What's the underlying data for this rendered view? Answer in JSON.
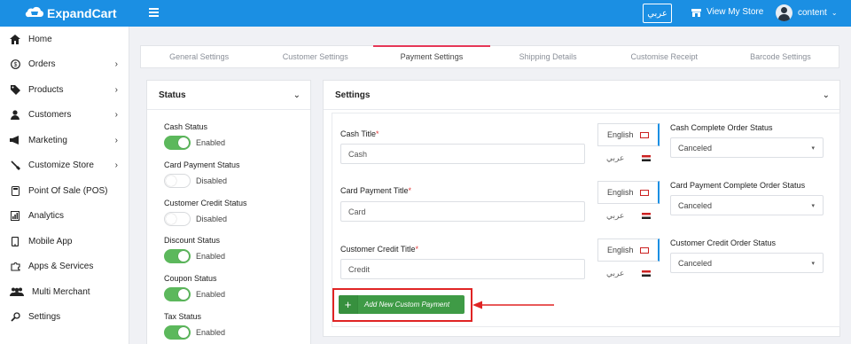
{
  "header": {
    "logo_text": "ExpandCart",
    "lang_button": "عربي",
    "view_store": "View My Store",
    "user_name": "content"
  },
  "sidebar": {
    "items": [
      {
        "label": "Home",
        "icon": "home-icon",
        "has_children": false
      },
      {
        "label": "Orders",
        "icon": "dollar-icon",
        "has_children": true
      },
      {
        "label": "Products",
        "icon": "tag-icon",
        "has_children": true
      },
      {
        "label": "Customers",
        "icon": "user-icon",
        "has_children": true
      },
      {
        "label": "Marketing",
        "icon": "megaphone-icon",
        "has_children": true
      },
      {
        "label": "Customize Store",
        "icon": "brush-icon",
        "has_children": true
      },
      {
        "label": "Point Of Sale (POS)",
        "icon": "pos-icon",
        "has_children": false
      },
      {
        "label": "Analytics",
        "icon": "chart-icon",
        "has_children": false
      },
      {
        "label": "Mobile App",
        "icon": "mobile-icon",
        "has_children": false
      },
      {
        "label": "Apps & Services",
        "icon": "puzzle-icon",
        "has_children": false
      },
      {
        "label": "Multi Merchant",
        "icon": "group-icon",
        "has_children": false
      },
      {
        "label": "Settings",
        "icon": "gear-icon",
        "has_children": false
      }
    ]
  },
  "tabs": [
    {
      "label": "General Settings",
      "active": false
    },
    {
      "label": "Customer Settings",
      "active": false
    },
    {
      "label": "Payment Settings",
      "active": true
    },
    {
      "label": "Shipping Details",
      "active": false
    },
    {
      "label": "Customise Receipt",
      "active": false
    },
    {
      "label": "Barcode Settings",
      "active": false
    }
  ],
  "status_panel": {
    "title": "Status",
    "items": [
      {
        "label": "Cash Status",
        "enabled": true,
        "state_text": "Enabled"
      },
      {
        "label": "Card Payment Status",
        "enabled": false,
        "state_text": "Disabled"
      },
      {
        "label": "Customer Credit Status",
        "enabled": false,
        "state_text": "Disabled"
      },
      {
        "label": "Discount Status",
        "enabled": true,
        "state_text": "Enabled"
      },
      {
        "label": "Coupon Status",
        "enabled": true,
        "state_text": "Enabled"
      },
      {
        "label": "Tax Status",
        "enabled": true,
        "state_text": "Enabled"
      }
    ]
  },
  "settings_panel": {
    "title": "Settings",
    "fields": [
      {
        "label": "Cash Title",
        "value": "Cash",
        "lang_en": "English",
        "lang_ar": "عربي",
        "status_label": "Cash Complete Order Status",
        "status_value": "Canceled"
      },
      {
        "label": "Card Payment Title",
        "value": "Card",
        "lang_en": "English",
        "lang_ar": "عربي",
        "status_label": "Card Payment Complete Order Status",
        "status_value": "Canceled"
      },
      {
        "label": "Customer Credit Title",
        "value": "Credit",
        "lang_en": "English",
        "lang_ar": "عربي",
        "status_label": "Customer Credit Order Status",
        "status_value": "Canceled"
      }
    ],
    "add_button": "Add New Custom Payment"
  },
  "colors": {
    "topbar": "#1b8fe3",
    "toggle_on": "#5cb85c",
    "add_button": "#3f9b46",
    "highlight": "#e02424",
    "active_tab": "#e63757"
  }
}
